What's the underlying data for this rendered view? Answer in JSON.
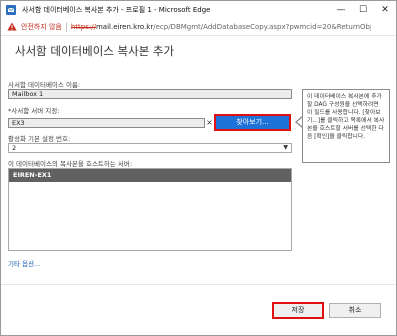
{
  "window": {
    "title": "사서함 데이터베이스 복사본 추가 - 프로필 1 - Microsoft Edge",
    "minimize": "—",
    "maximize": "☐",
    "close": "✕"
  },
  "address_bar": {
    "security_label": "안전하지 않음",
    "url_protocol": "https://",
    "url_domain": "mail.eiren.kro.kr",
    "url_path": "/ecp/DBMgmt/AddDatabaseCopy.aspx?pwmcid=20&ReturnObject..."
  },
  "form": {
    "heading": "사서함 데이터베이스 복사본 추가",
    "db_name_label": "사서함 데이터베이스 이름:",
    "db_name_value": "Mailbox 1",
    "server_label": "*사서함 서버 지정:",
    "server_value": "EX3",
    "clear_symbol": "×",
    "browse_button": "찾아보기...",
    "activation_label": "활성화 기본 설정 번호:",
    "activation_value": "2",
    "hosting_servers_label": "이 데이터베이스의 복사본을 호스트하는 서버:",
    "hosting_servers": [
      "EIREN-EX1"
    ],
    "more_options": "기타 옵션..."
  },
  "callout": {
    "text": "이 데이터베이스 복사본에 추가할 DAG 구성원을 선택하려면 이 필드를 사용합니다. [찾아보기...]를 클릭하고 목록에서 복사본을 호스트할 서버를 선택한 다음 [확인]을 클릭합니다."
  },
  "buttons": {
    "save": "저장",
    "cancel": "취소"
  },
  "colors": {
    "primary_button": "#1f72d8",
    "highlight_border": "#e01010",
    "selected_row": "#616161",
    "insecure": "#c42b1c"
  }
}
